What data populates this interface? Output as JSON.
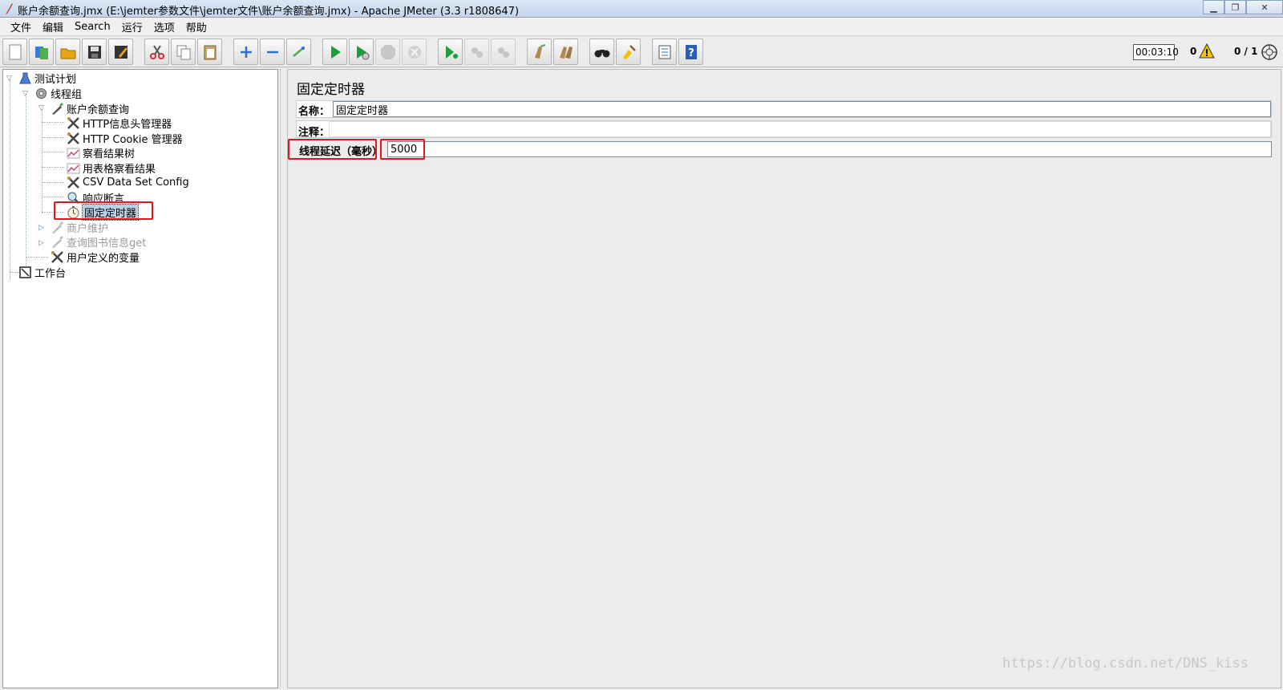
{
  "window": {
    "title": "账户余额查询.jmx (E:\\jemter参数文件\\jemter文件\\账户余额查询.jmx) - Apache JMeter (3.3 r1808647)",
    "minimize_icon": "minimize-icon",
    "restore_icon": "restore-icon",
    "close_icon": "close-icon"
  },
  "menubar": {
    "items": [
      "文件",
      "编辑",
      "Search",
      "运行",
      "选项",
      "帮助"
    ]
  },
  "toolbar": {
    "buttons": [
      "new-icon",
      "templates-icon",
      "open-icon",
      "save-icon",
      "save-as-icon",
      "cut-icon",
      "copy-icon",
      "paste-icon",
      "expand-icon",
      "collapse-icon",
      "toggle-icon",
      "start-icon",
      "start-no-timers-icon",
      "stop-icon",
      "shutdown-icon",
      "remote-start-icon",
      "remote-stop-icon",
      "remote-shutdown-icon",
      "clear-icon",
      "clear-all-icon",
      "search-icon",
      "reset-search-icon",
      "function-helper-icon",
      "help-icon"
    ],
    "timer": "00:03:10",
    "error_count": "0",
    "threads": "0 / 1"
  },
  "tree": {
    "nodes": [
      {
        "label": "测试计划",
        "icon": "flask-icon"
      },
      {
        "label": "线程组",
        "icon": "gear-icon"
      },
      {
        "label": "账户余额查询",
        "icon": "pipette-icon"
      },
      {
        "label": "HTTP信息头管理器",
        "icon": "tools-icon"
      },
      {
        "label": "HTTP Cookie 管理器",
        "icon": "tools-icon"
      },
      {
        "label": "察看结果树",
        "icon": "chart-icon"
      },
      {
        "label": "用表格察看结果",
        "icon": "chart-icon"
      },
      {
        "label": "CSV Data Set Config",
        "icon": "tools-icon"
      },
      {
        "label": "响应断言",
        "icon": "magnifier-icon"
      },
      {
        "label": "固定定时器",
        "icon": "stopwatch-icon"
      },
      {
        "label": "商户维护",
        "icon": "pipette-icon"
      },
      {
        "label": "查询图书信息get",
        "icon": "pipette-icon"
      },
      {
        "label": "用户定义的变量",
        "icon": "tools-icon"
      },
      {
        "label": "工作台",
        "icon": "workbench-icon"
      }
    ]
  },
  "panel": {
    "title": "固定定时器",
    "name_label": "名称：",
    "name_value": "固定定时器",
    "comment_label": "注释：",
    "comment_value": "",
    "delay_label": "线程延迟（毫秒）",
    "delay_value": "5000"
  },
  "watermark": "https://blog.csdn.net/DNS_kiss"
}
